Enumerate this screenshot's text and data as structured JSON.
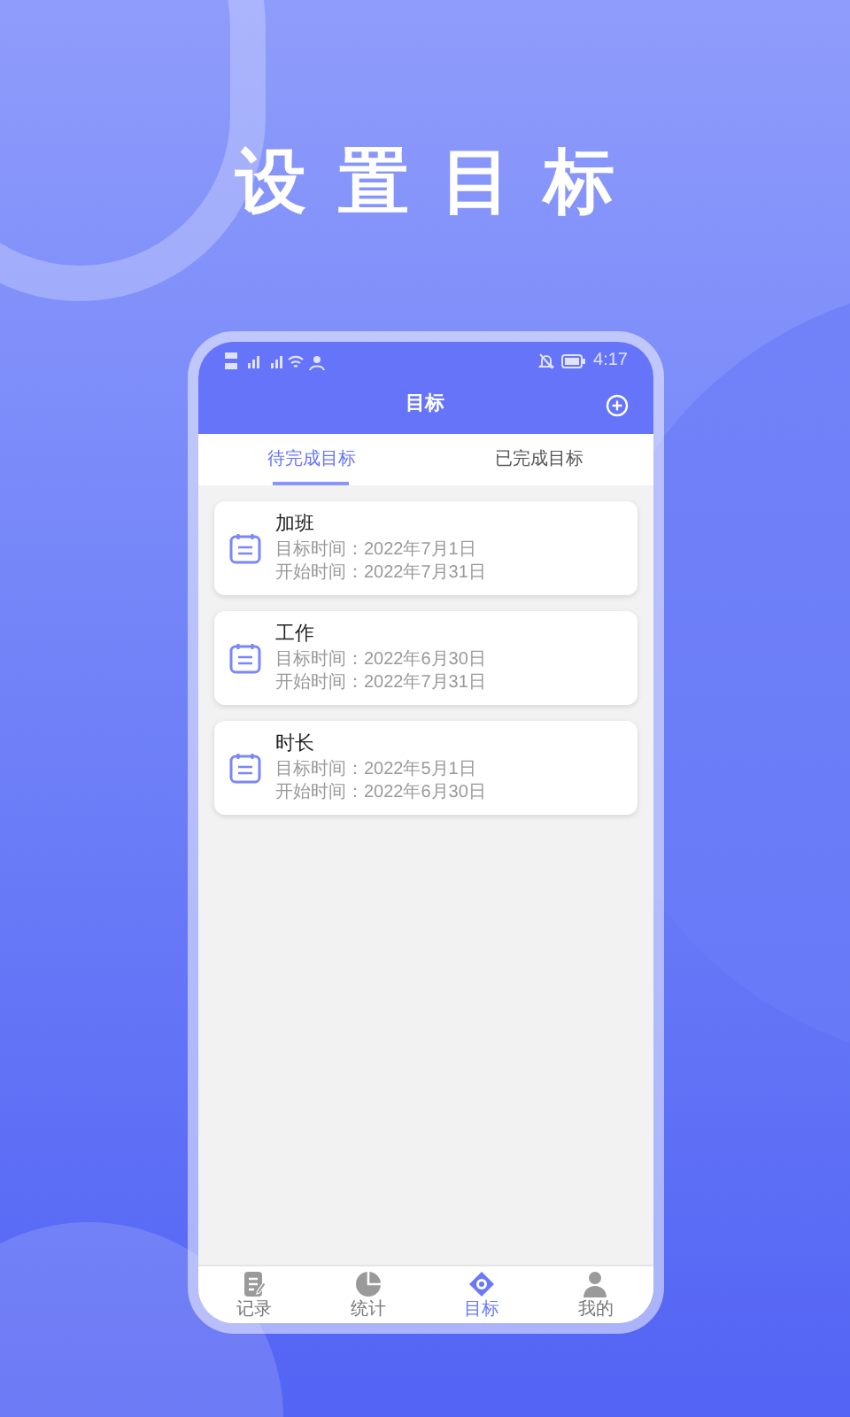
{
  "title": "设置目标",
  "status_bar": {
    "time": "4:17"
  },
  "header": {
    "title": "目标"
  },
  "tabs": [
    {
      "label": "待完成目标",
      "selected": true
    },
    {
      "label": "已完成目标",
      "selected": false
    }
  ],
  "goals": [
    {
      "name": "加班",
      "target": "目标时间：2022年7月1日",
      "start": "开始时间：2022年7月31日"
    },
    {
      "name": "工作",
      "target": "目标时间：2022年6月30日",
      "start": "开始时间：2022年7月31日"
    },
    {
      "name": "时长",
      "target": "目标时间：2022年5月1日",
      "start": "开始时间：2022年6月30日"
    }
  ],
  "nav": [
    {
      "label": "记录",
      "kind": "note",
      "selected": false
    },
    {
      "label": "统计",
      "kind": "pie",
      "selected": false
    },
    {
      "label": "目标",
      "kind": "target",
      "selected": true
    },
    {
      "label": "我的",
      "kind": "person",
      "selected": false
    }
  ]
}
